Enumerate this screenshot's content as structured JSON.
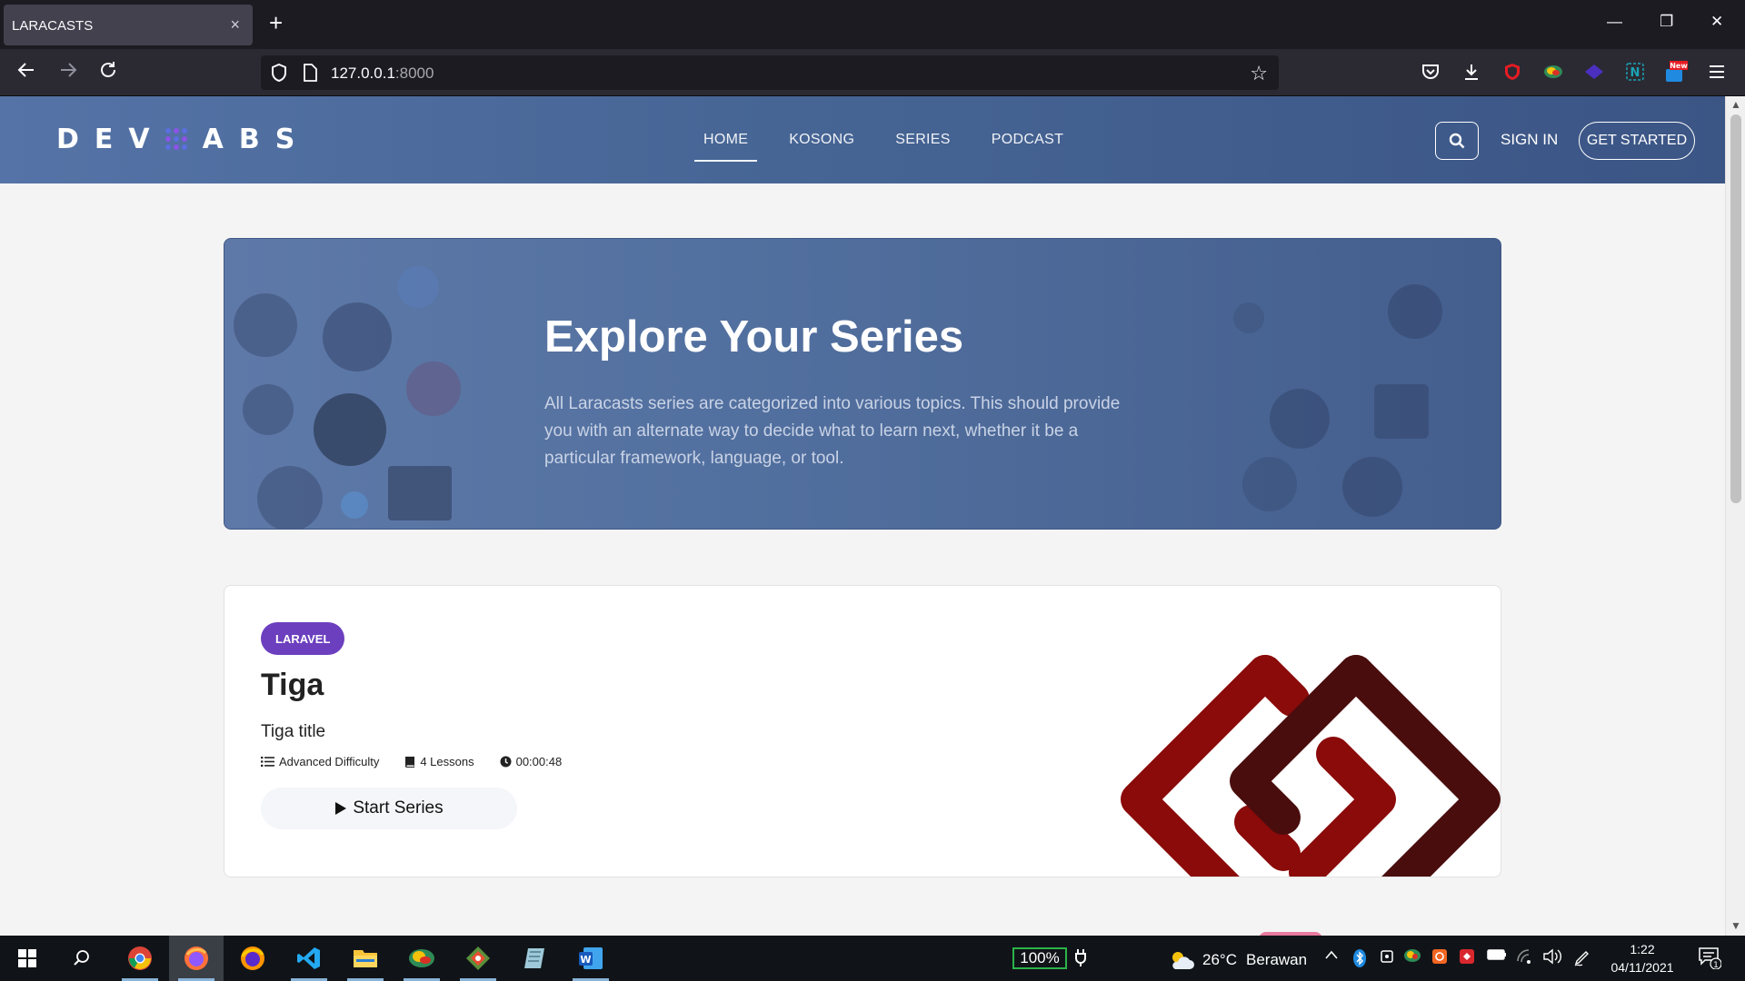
{
  "browser": {
    "tab_title": "LARACASTS",
    "tab_close": "×",
    "new_tab": "+",
    "url_host": "127.0.0.1",
    "url_port": ":8000",
    "win_minimize": "—",
    "win_restore": "❐",
    "win_close": "✕"
  },
  "site": {
    "logo_letters_left": [
      "D",
      "E",
      "V"
    ],
    "logo_letters_right": [
      "A",
      "B",
      "S"
    ],
    "menu": [
      "HOME",
      "KOSONG",
      "SERIES",
      "PODCAST"
    ],
    "active_menu": "HOME",
    "signin": "SIGN IN",
    "get_started": "GET STARTED"
  },
  "hero": {
    "title": "Explore Your Series",
    "text": "All Laracasts series are categorized into various topics. This should provide you with an alternate way to decide what to learn next, whether it be a particular framework, language, or tool."
  },
  "series_card": {
    "badge": "LARAVEL",
    "title": "Tiga",
    "subtitle": "Tiga title",
    "difficulty": "Advanced Difficulty",
    "lessons": "4 Lessons",
    "duration": "00:00:48",
    "start_button": "Start Series"
  },
  "taskbar": {
    "battery": "100%",
    "temperature": "26°C",
    "weather": "Berawan",
    "time": "1:22",
    "date": "04/11/2021",
    "notification_count": "1"
  },
  "colors": {
    "header_gradient": [
      "#5573a6",
      "#3b5585"
    ],
    "badge": "#6c3fbf",
    "logo_red": "#8b0a0a",
    "logo_dark": "#4a0d0d"
  }
}
